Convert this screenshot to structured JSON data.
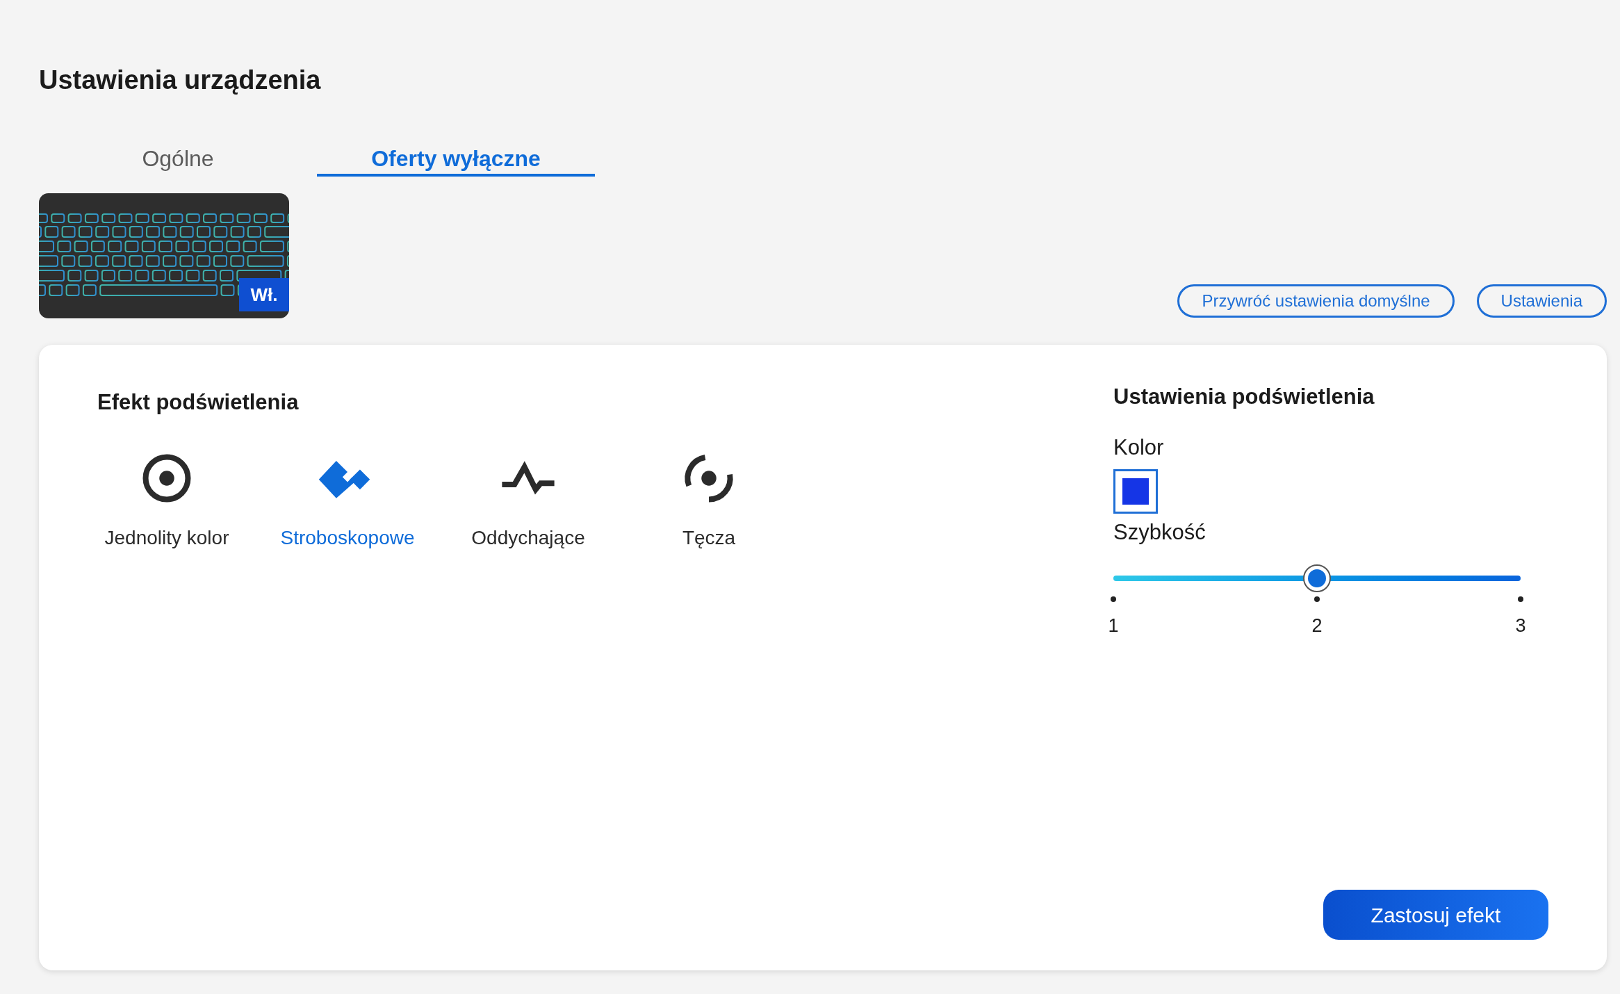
{
  "page_title": "Ustawienia urządzenia",
  "tabs": [
    {
      "label": "Ogólne",
      "selected": false
    },
    {
      "label": "Oferty wyłączne",
      "selected": true
    }
  ],
  "device": {
    "badge": "Wł."
  },
  "actions": [
    "Przywróć ustawienia domyślne",
    "Ustawienia"
  ],
  "effects": {
    "title": "Efekt podświetlenia",
    "items": [
      {
        "kind": "solid",
        "label": "Jednolity kolor",
        "selected": false
      },
      {
        "kind": "strobe",
        "label": "Stroboskopowe",
        "selected": true
      },
      {
        "kind": "breathing",
        "label": "Oddychające",
        "selected": false
      },
      {
        "kind": "rainbow",
        "label": "Tęcza",
        "selected": false
      }
    ]
  },
  "settings": {
    "title": "Ustawienia podświetlenia",
    "color_label": "Kolor",
    "color": "#1535e6",
    "speed_label": "Szybkość",
    "speed": {
      "level": 0.5,
      "ticks": [
        "1",
        "2",
        "3"
      ]
    }
  },
  "apply_button": "Zastosuj efekt"
}
